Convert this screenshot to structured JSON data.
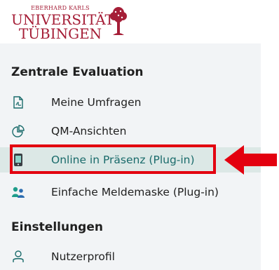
{
  "logo": {
    "line1": "EBERHARD KARLS",
    "line2": "UNIVERSITÄT",
    "line3": "TÜBINGEN",
    "color": "#a51e37"
  },
  "sections": [
    {
      "heading": "Zentrale Evaluation",
      "items": [
        {
          "label": "Meine Umfragen",
          "icon": "pdf-document-icon"
        },
        {
          "label": "QM-Ansichten",
          "icon": "pie-chart-icon"
        },
        {
          "label": "Online in Präsenz (Plug-in)",
          "icon": "mobile-phone-icon",
          "active": true
        },
        {
          "label": "Einfache Meldemaske (Plug-in)",
          "icon": "people-group-icon"
        }
      ]
    },
    {
      "heading": "Einstellungen",
      "items": [
        {
          "label": "Nutzerprofil",
          "icon": "user-icon"
        }
      ]
    }
  ],
  "colors": {
    "accent": "#1a6b6b",
    "active_background": "#dce8e6",
    "highlight": "#e3000f"
  }
}
